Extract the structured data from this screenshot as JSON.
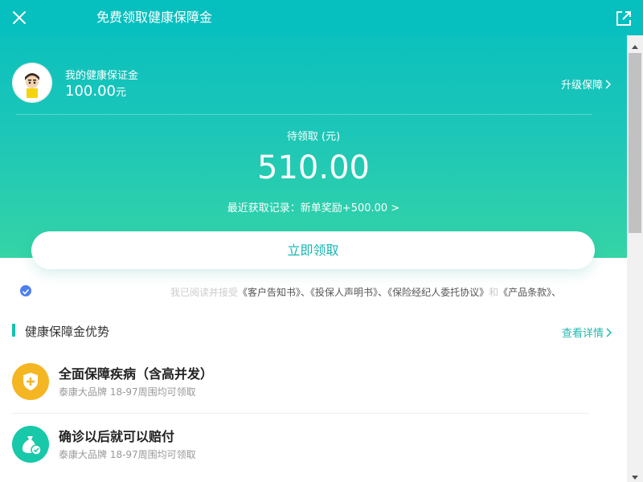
{
  "header": {
    "title": "免费领取健康保障金",
    "close_icon": "close-icon",
    "share_icon": "external-link-icon"
  },
  "account": {
    "label": "我的健康保证金",
    "amount": "100.00",
    "unit": "元",
    "upgrade_label": "升级保障"
  },
  "pending": {
    "label": "待领取 (元)",
    "amount": "510.00",
    "recent": "最近获取记录：新单奖励+500.00 >"
  },
  "claim_button": "立即领取",
  "agreement": {
    "prefix": "我已阅读并接受",
    "doc1": "《客户告知书》",
    "sep1": "、",
    "doc2": "《投保人声明书》",
    "sep2": "、",
    "doc3": "《保险经纪人委托协议》",
    "and": "和",
    "doc4": "《产品条款》",
    "sep3": "、"
  },
  "benefits_section": {
    "title": "健康保障金优势",
    "detail_link": "查看详情",
    "items": [
      {
        "title": "全面保障疾病（含高并发）",
        "subtitle": "泰康大品牌 18-97周围均可领取",
        "icon": "shield-plus-icon"
      },
      {
        "title": "确诊以后就可以赔付",
        "subtitle": "泰康大品牌 18-97周围均可领取",
        "icon": "money-bag-check-icon"
      }
    ]
  },
  "colors": {
    "brand_teal": "#06bfbf",
    "gradient_end": "#35d4a6",
    "accent_text": "#16b7b3",
    "icon_gold": "#f5b623",
    "icon_teal": "#17c9a8",
    "check_blue": "#4e7ff2"
  }
}
